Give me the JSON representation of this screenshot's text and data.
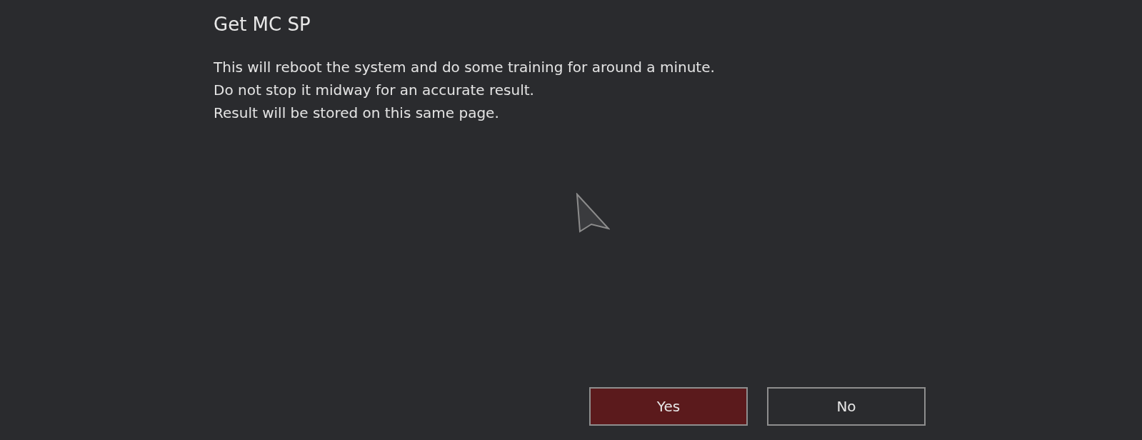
{
  "dialog": {
    "title": "Get MC SP",
    "message": [
      "This will reboot the system and do some training for around a minute.",
      "Do not stop it midway for an accurate result.",
      "Result will be stored on this same page."
    ],
    "buttons": [
      {
        "label": "Yes",
        "selected": true
      },
      {
        "label": "No",
        "selected": false
      }
    ]
  }
}
